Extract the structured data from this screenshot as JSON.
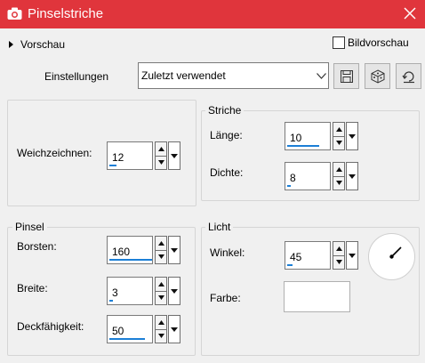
{
  "window": {
    "title": "Pinselstriche",
    "app_icon": "camera-icon",
    "close_icon": "close-icon",
    "title_bar_color": "#e0353c"
  },
  "preview": {
    "label": "Vorschau"
  },
  "bild_preview": {
    "label": "Bildvorschau",
    "checked": false
  },
  "presets": {
    "label": "Einstellungen",
    "selected": "Zuletzt verwendet",
    "buttons": [
      "save-icon",
      "random-dice-icon",
      "reset-icon"
    ]
  },
  "weichzeichnen": {
    "label": "Weichzeichnen:",
    "value": "12"
  },
  "striche": {
    "title": "Striche",
    "laenge": {
      "label": "Länge:",
      "value": "10"
    },
    "dichte": {
      "label": "Dichte:",
      "value": "8"
    }
  },
  "pinsel": {
    "title": "Pinsel",
    "borsten": {
      "label": "Borsten:",
      "value": "160"
    },
    "breite": {
      "label": "Breite:",
      "value": "3"
    },
    "deckfaehigkeit": {
      "label": "Deckfähigkeit:",
      "value": "50"
    }
  },
  "licht": {
    "title": "Licht",
    "winkel": {
      "label": "Winkel:",
      "value": "45"
    },
    "farbe": {
      "label": "Farbe:",
      "color": "#ffffff"
    },
    "dial_icon": "angle-dial-icon"
  },
  "accent_color": "#1c7fd6"
}
